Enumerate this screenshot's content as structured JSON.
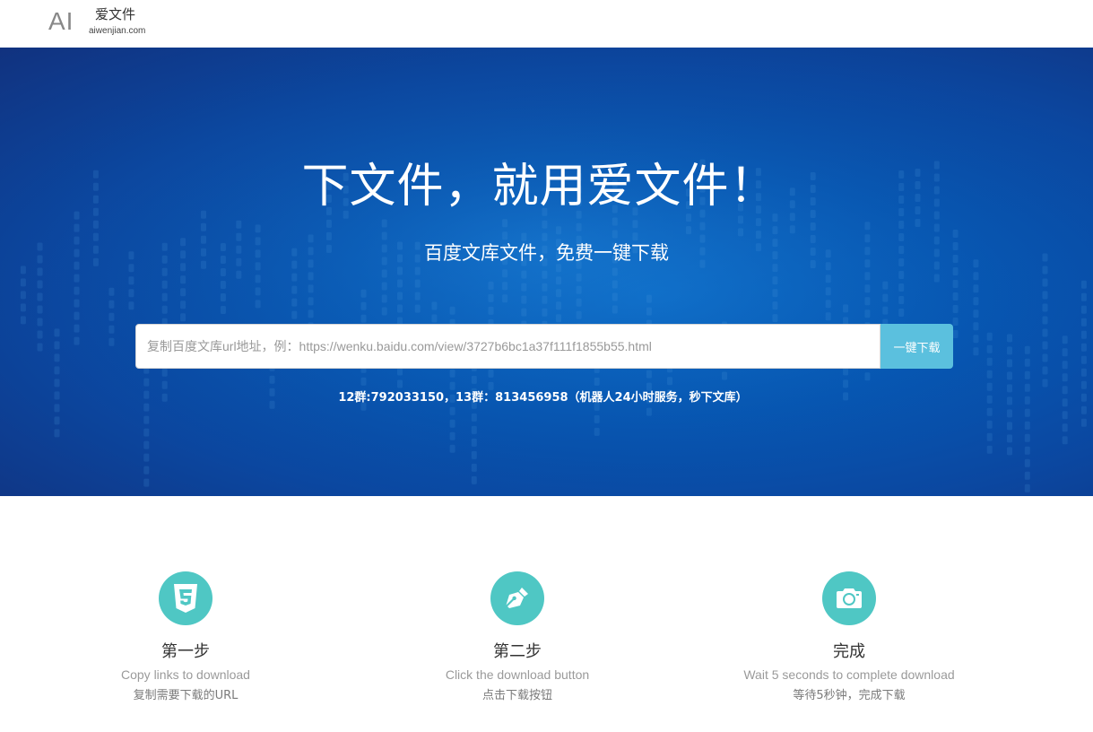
{
  "header": {
    "logo_text": "AI",
    "brand_name": "爱文件",
    "brand_domain": "aiwenjian.com"
  },
  "hero": {
    "title": "下文件，就用爱文件！",
    "subtitle": "百度文库文件，免费一键下载",
    "search": {
      "placeholder": "复制百度文库url地址，例：https://wenku.baidu.com/view/3727b6bc1a37f111f1855b55.html",
      "value": "",
      "button_label": "一键下载"
    },
    "group_info": "12群:792033150，13群：813456958（机器人24小时服务，秒下文库）"
  },
  "steps": [
    {
      "icon": "css3-icon",
      "title": "第一步",
      "en": "Copy links to download",
      "cn": "复制需要下载的URL"
    },
    {
      "icon": "pen-nib-icon",
      "title": "第二步",
      "en": "Click the download button",
      "cn": "点击下载按钮"
    },
    {
      "icon": "camera-icon",
      "title": "完成",
      "en": "Wait 5 seconds to complete download",
      "cn": "等待5秒钟，完成下载"
    }
  ],
  "colors": {
    "hero_bg": "#0657b3",
    "accent_button": "#5bc0de",
    "step_icon_bg": "#4fc7c4"
  }
}
